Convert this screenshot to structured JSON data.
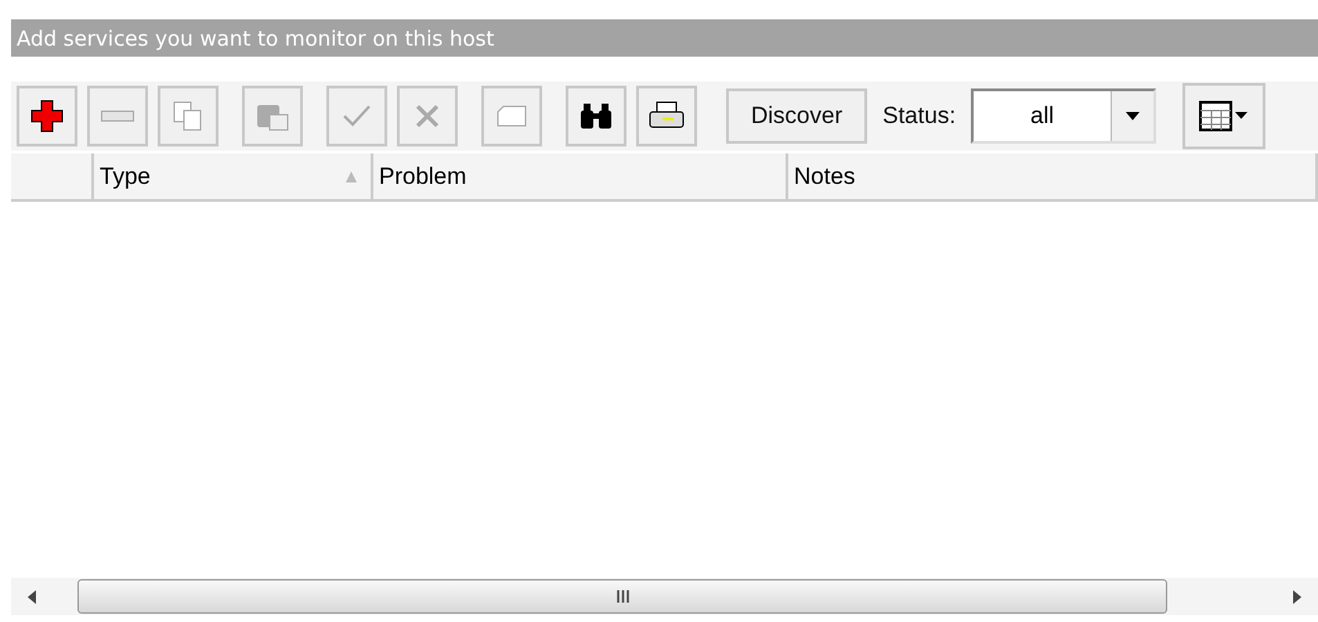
{
  "header": {
    "title": "Add services you want to monitor on this host"
  },
  "toolbar": {
    "buttons": [
      {
        "kind": "add",
        "disabled": false
      },
      {
        "kind": "remove",
        "disabled": true
      },
      {
        "kind": "copy",
        "disabled": true
      },
      {
        "kind": "paste",
        "disabled": true
      },
      {
        "kind": "approve",
        "disabled": true
      },
      {
        "kind": "reject",
        "disabled": true
      },
      {
        "kind": "card",
        "disabled": true
      },
      {
        "kind": "find",
        "disabled": false
      },
      {
        "kind": "print",
        "disabled": false
      }
    ],
    "discover": "Discover",
    "status_label": "Status:",
    "status_value": "all"
  },
  "table": {
    "columns": [
      {},
      {
        "label": "Type",
        "sorted": true
      },
      {
        "label": "Problem",
        "sorted": false
      },
      {
        "label": "Notes",
        "sorted": false
      }
    ]
  }
}
